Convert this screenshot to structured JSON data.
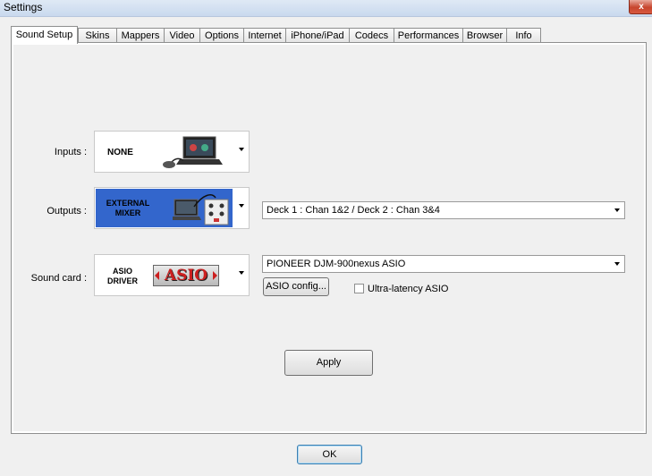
{
  "window": {
    "title": "Settings",
    "close_glyph": "x"
  },
  "tabs": [
    {
      "label": "Sound Setup",
      "active": true
    },
    {
      "label": "Skins"
    },
    {
      "label": "Mappers"
    },
    {
      "label": "Video"
    },
    {
      "label": "Options"
    },
    {
      "label": "Internet"
    },
    {
      "label": "iPhone/iPad"
    },
    {
      "label": "Codecs"
    },
    {
      "label": "Performances"
    },
    {
      "label": "Browser"
    },
    {
      "label": "Info"
    }
  ],
  "sound_setup": {
    "inputs": {
      "label": "Inputs :",
      "device": "NONE"
    },
    "outputs": {
      "label": "Outputs :",
      "device_line1": "EXTERNAL",
      "device_line2": "MIXER",
      "routing": "Deck 1 : Chan 1&2 / Deck 2 : Chan 3&4"
    },
    "sound_card": {
      "label": "Sound card :",
      "device_line1": "ASIO",
      "device_line2": "DRIVER",
      "logo_text": "ASIO",
      "selected": "PIONEER DJM-900nexus ASIO",
      "config_button": "ASIO config...",
      "ultra_latency_label": "Ultra-latency ASIO",
      "ultra_latency_checked": false
    },
    "apply_button": "Apply"
  },
  "footer": {
    "ok_button": "OK"
  },
  "colors": {
    "selected_device_bg": "#3366cc",
    "asio_logo_red": "#cc1f1f"
  }
}
